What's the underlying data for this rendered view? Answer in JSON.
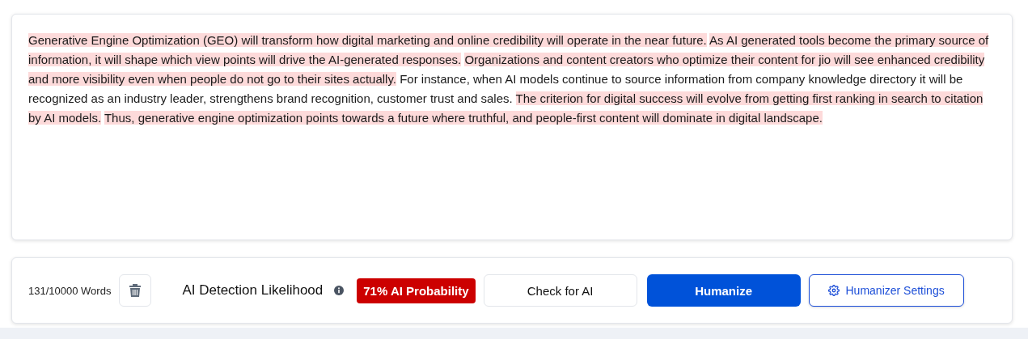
{
  "editor": {
    "sentences": [
      {
        "text": "Generative Engine Optimization (GEO) will transform how digital marketing and online credibility will operate in the near future.",
        "highlighted": true
      },
      {
        "text": "As AI generated tools become the primary source of information, it will shape which view points will drive the AI-generated responses.",
        "highlighted": true
      },
      {
        "text": "Organizations and content creators who optimize their content for jio will see enhanced credibility and more visibility even when people do not go to their sites actually.",
        "highlighted": true
      },
      {
        "text": "For instance, when AI models continue to source information from company knowledge directory it will be recognized as an industry leader, strengthens brand recognition, customer trust and sales.",
        "highlighted": false
      },
      {
        "text": "The criterion for digital success will evolve from getting first ranking in search to citation by AI models.",
        "highlighted": true
      },
      {
        "text": "Thus, generative engine optimization points towards a future where truthful, and people-first content will dominate in digital landscape.",
        "highlighted": true
      }
    ]
  },
  "toolbar": {
    "word_count": "131/10000 Words",
    "detection_label": "AI Detection Likelihood",
    "probability_badge": "71% AI Probability",
    "buttons": [
      {
        "label": "Check for AI",
        "kind": "secondary"
      },
      {
        "label": "Humanize",
        "kind": "primary"
      },
      {
        "label": "Humanizer Settings",
        "kind": "settings"
      }
    ]
  }
}
